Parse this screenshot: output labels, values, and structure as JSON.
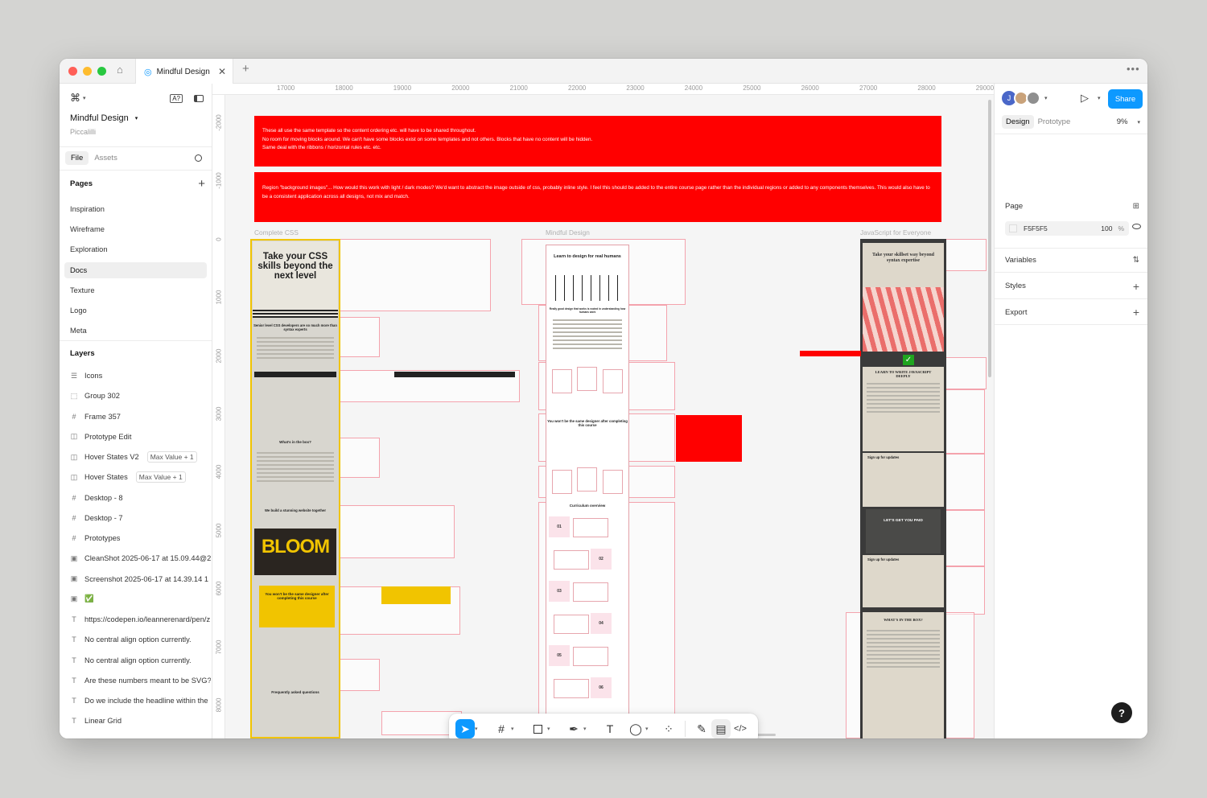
{
  "tab": {
    "title": "Mindful Design"
  },
  "file": {
    "name": "Mindful Design",
    "team": "Piccalilli"
  },
  "left_tabs": {
    "file": "File",
    "assets": "Assets"
  },
  "pages": {
    "header": "Pages",
    "items": [
      "Inspiration",
      "Wireframe",
      "Exploration",
      "Docs",
      "Texture",
      "Logo",
      "Meta"
    ],
    "selected": "Docs"
  },
  "layers": {
    "header": "Layers",
    "items": [
      {
        "icon": "list-icon",
        "label": "Icons",
        "badge": ""
      },
      {
        "icon": "group-icon",
        "label": "Group 302",
        "badge": ""
      },
      {
        "icon": "frame-icon",
        "label": "Frame 357",
        "badge": ""
      },
      {
        "icon": "component-icon",
        "label": "Prototype Edit",
        "badge": ""
      },
      {
        "icon": "variants-icon",
        "label": "Hover States V2",
        "badge": "Max Value + 1"
      },
      {
        "icon": "variants-icon",
        "label": "Hover States",
        "badge": "Max Value + 1"
      },
      {
        "icon": "frame-icon",
        "label": "Desktop - 8",
        "badge": ""
      },
      {
        "icon": "frame-icon",
        "label": "Desktop - 7",
        "badge": ""
      },
      {
        "icon": "frame-icon",
        "label": "Prototypes",
        "badge": ""
      },
      {
        "icon": "image-icon",
        "label": "CleanShot 2025-06-17 at 15.09.44@2",
        "badge": ""
      },
      {
        "icon": "image-icon",
        "label": "Screenshot 2025-06-17 at 14.39.14 1",
        "badge": ""
      },
      {
        "icon": "image-icon",
        "label": "✅",
        "badge": ""
      },
      {
        "icon": "text-icon",
        "label": "https://codepen.io/leannerenard/pen/z",
        "badge": ""
      },
      {
        "icon": "text-icon",
        "label": "No central align option currently.",
        "badge": ""
      },
      {
        "icon": "text-icon",
        "label": "No central align option currently.",
        "badge": ""
      },
      {
        "icon": "text-icon",
        "label": "Are these numbers meant to be SVG?",
        "badge": ""
      },
      {
        "icon": "text-icon",
        "label": "Do we include the headline within the",
        "badge": ""
      },
      {
        "icon": "text-icon",
        "label": "Linear Grid",
        "badge": ""
      }
    ]
  },
  "ruler": {
    "top": [
      "17000",
      "18000",
      "19000",
      "20000",
      "21000",
      "22000",
      "23000",
      "24000",
      "25000",
      "26000",
      "27000",
      "28000",
      "29000"
    ],
    "left": [
      "-2000",
      "-1000",
      "0",
      "1000",
      "2000",
      "3000",
      "4000",
      "5000",
      "6000",
      "7000",
      "8000"
    ]
  },
  "notes": {
    "band1": "These all use the same template so the content ordering etc. will have to be shared throughout.\nNo room for moving blocks around. We can't have some blocks exist on some templates and not others. Blocks that have no content will be hidden.\nSame deal with the ribbons / horizontal rules etc. etc.",
    "band2": "Region \"background images\"... How would this work with light / dark modes? We'd want to abstract the image outside of css, probably inline style. I feel this should be added to the entire course page rather than the individual regions or added to any components themselves. This would also have to be a consistent application across all designs, not mix and match."
  },
  "frames": {
    "f1": "Complete CSS",
    "f2": "Mindful Design",
    "f3": "JavaScript for Everyone"
  },
  "artboard_text": {
    "css_hero": "Take your CSS skills beyond the next level",
    "css_senior": "Senior level CSS developers are so much more than syntax experts",
    "css_box": "What's in the box?",
    "css_build": "We build a stunning website together",
    "css_bloom": "BLOOM",
    "css_same": "You won't be the same designer after completing this course",
    "css_faq": "Frequently asked questions",
    "md_hero": "Learn to design for real humans",
    "md_good": "Really good design that works is rooted in understanding how humans work",
    "md_same": "You won't be the same designer after completing this course",
    "md_curr": "Curriculum overview",
    "md_nums": [
      "01",
      "02",
      "03",
      "04",
      "05",
      "06"
    ],
    "js_hero": "Take your skillset way beyond syntax expertise",
    "js_learn": "LEARN TO WRITE JAVASCRIPT DEEPLY",
    "js_signup": "Sign up for updates",
    "js_paid": "LET'S GET YOU PAID",
    "js_signup2": "Sign up for updates",
    "js_box": "WHAT'S IN THE BOX?"
  },
  "right_panel": {
    "share": "Share",
    "avatar_initial": "J",
    "tabs": [
      "Design",
      "Prototype"
    ],
    "zoom": "9%",
    "page_label": "Page",
    "bg_color": "F5F5F5",
    "bg_opacity": "100",
    "bg_pct": "%",
    "sections": [
      "Variables",
      "Styles",
      "Export"
    ]
  },
  "colors": {
    "accent": "#0d99ff",
    "annotation_red": "#ff0000",
    "complete_css_yellow": "#f1c400",
    "js_dark": "#3a3a3a"
  }
}
